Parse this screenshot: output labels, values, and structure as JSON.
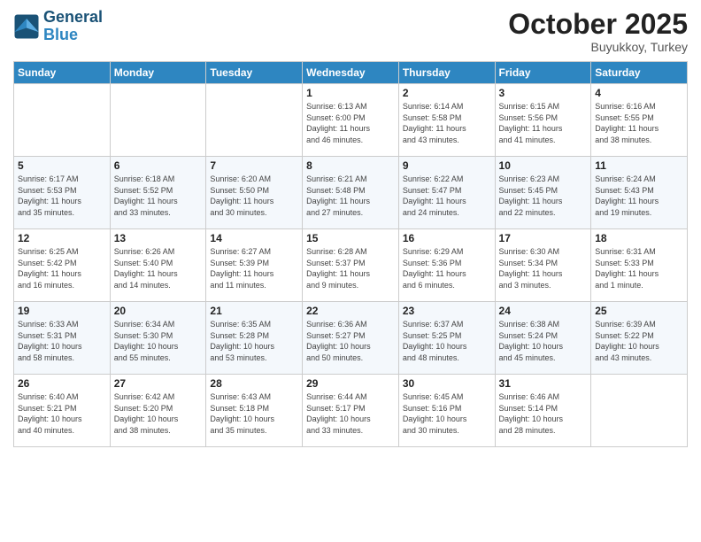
{
  "header": {
    "logo_line1": "General",
    "logo_line2": "Blue",
    "month": "October 2025",
    "location": "Buyukkoy, Turkey"
  },
  "weekdays": [
    "Sunday",
    "Monday",
    "Tuesday",
    "Wednesday",
    "Thursday",
    "Friday",
    "Saturday"
  ],
  "weeks": [
    [
      {
        "day": "",
        "info": ""
      },
      {
        "day": "",
        "info": ""
      },
      {
        "day": "",
        "info": ""
      },
      {
        "day": "1",
        "info": "Sunrise: 6:13 AM\nSunset: 6:00 PM\nDaylight: 11 hours\nand 46 minutes."
      },
      {
        "day": "2",
        "info": "Sunrise: 6:14 AM\nSunset: 5:58 PM\nDaylight: 11 hours\nand 43 minutes."
      },
      {
        "day": "3",
        "info": "Sunrise: 6:15 AM\nSunset: 5:56 PM\nDaylight: 11 hours\nand 41 minutes."
      },
      {
        "day": "4",
        "info": "Sunrise: 6:16 AM\nSunset: 5:55 PM\nDaylight: 11 hours\nand 38 minutes."
      }
    ],
    [
      {
        "day": "5",
        "info": "Sunrise: 6:17 AM\nSunset: 5:53 PM\nDaylight: 11 hours\nand 35 minutes."
      },
      {
        "day": "6",
        "info": "Sunrise: 6:18 AM\nSunset: 5:52 PM\nDaylight: 11 hours\nand 33 minutes."
      },
      {
        "day": "7",
        "info": "Sunrise: 6:20 AM\nSunset: 5:50 PM\nDaylight: 11 hours\nand 30 minutes."
      },
      {
        "day": "8",
        "info": "Sunrise: 6:21 AM\nSunset: 5:48 PM\nDaylight: 11 hours\nand 27 minutes."
      },
      {
        "day": "9",
        "info": "Sunrise: 6:22 AM\nSunset: 5:47 PM\nDaylight: 11 hours\nand 24 minutes."
      },
      {
        "day": "10",
        "info": "Sunrise: 6:23 AM\nSunset: 5:45 PM\nDaylight: 11 hours\nand 22 minutes."
      },
      {
        "day": "11",
        "info": "Sunrise: 6:24 AM\nSunset: 5:43 PM\nDaylight: 11 hours\nand 19 minutes."
      }
    ],
    [
      {
        "day": "12",
        "info": "Sunrise: 6:25 AM\nSunset: 5:42 PM\nDaylight: 11 hours\nand 16 minutes."
      },
      {
        "day": "13",
        "info": "Sunrise: 6:26 AM\nSunset: 5:40 PM\nDaylight: 11 hours\nand 14 minutes."
      },
      {
        "day": "14",
        "info": "Sunrise: 6:27 AM\nSunset: 5:39 PM\nDaylight: 11 hours\nand 11 minutes."
      },
      {
        "day": "15",
        "info": "Sunrise: 6:28 AM\nSunset: 5:37 PM\nDaylight: 11 hours\nand 9 minutes."
      },
      {
        "day": "16",
        "info": "Sunrise: 6:29 AM\nSunset: 5:36 PM\nDaylight: 11 hours\nand 6 minutes."
      },
      {
        "day": "17",
        "info": "Sunrise: 6:30 AM\nSunset: 5:34 PM\nDaylight: 11 hours\nand 3 minutes."
      },
      {
        "day": "18",
        "info": "Sunrise: 6:31 AM\nSunset: 5:33 PM\nDaylight: 11 hours\nand 1 minute."
      }
    ],
    [
      {
        "day": "19",
        "info": "Sunrise: 6:33 AM\nSunset: 5:31 PM\nDaylight: 10 hours\nand 58 minutes."
      },
      {
        "day": "20",
        "info": "Sunrise: 6:34 AM\nSunset: 5:30 PM\nDaylight: 10 hours\nand 55 minutes."
      },
      {
        "day": "21",
        "info": "Sunrise: 6:35 AM\nSunset: 5:28 PM\nDaylight: 10 hours\nand 53 minutes."
      },
      {
        "day": "22",
        "info": "Sunrise: 6:36 AM\nSunset: 5:27 PM\nDaylight: 10 hours\nand 50 minutes."
      },
      {
        "day": "23",
        "info": "Sunrise: 6:37 AM\nSunset: 5:25 PM\nDaylight: 10 hours\nand 48 minutes."
      },
      {
        "day": "24",
        "info": "Sunrise: 6:38 AM\nSunset: 5:24 PM\nDaylight: 10 hours\nand 45 minutes."
      },
      {
        "day": "25",
        "info": "Sunrise: 6:39 AM\nSunset: 5:22 PM\nDaylight: 10 hours\nand 43 minutes."
      }
    ],
    [
      {
        "day": "26",
        "info": "Sunrise: 6:40 AM\nSunset: 5:21 PM\nDaylight: 10 hours\nand 40 minutes."
      },
      {
        "day": "27",
        "info": "Sunrise: 6:42 AM\nSunset: 5:20 PM\nDaylight: 10 hours\nand 38 minutes."
      },
      {
        "day": "28",
        "info": "Sunrise: 6:43 AM\nSunset: 5:18 PM\nDaylight: 10 hours\nand 35 minutes."
      },
      {
        "day": "29",
        "info": "Sunrise: 6:44 AM\nSunset: 5:17 PM\nDaylight: 10 hours\nand 33 minutes."
      },
      {
        "day": "30",
        "info": "Sunrise: 6:45 AM\nSunset: 5:16 PM\nDaylight: 10 hours\nand 30 minutes."
      },
      {
        "day": "31",
        "info": "Sunrise: 6:46 AM\nSunset: 5:14 PM\nDaylight: 10 hours\nand 28 minutes."
      },
      {
        "day": "",
        "info": ""
      }
    ]
  ]
}
